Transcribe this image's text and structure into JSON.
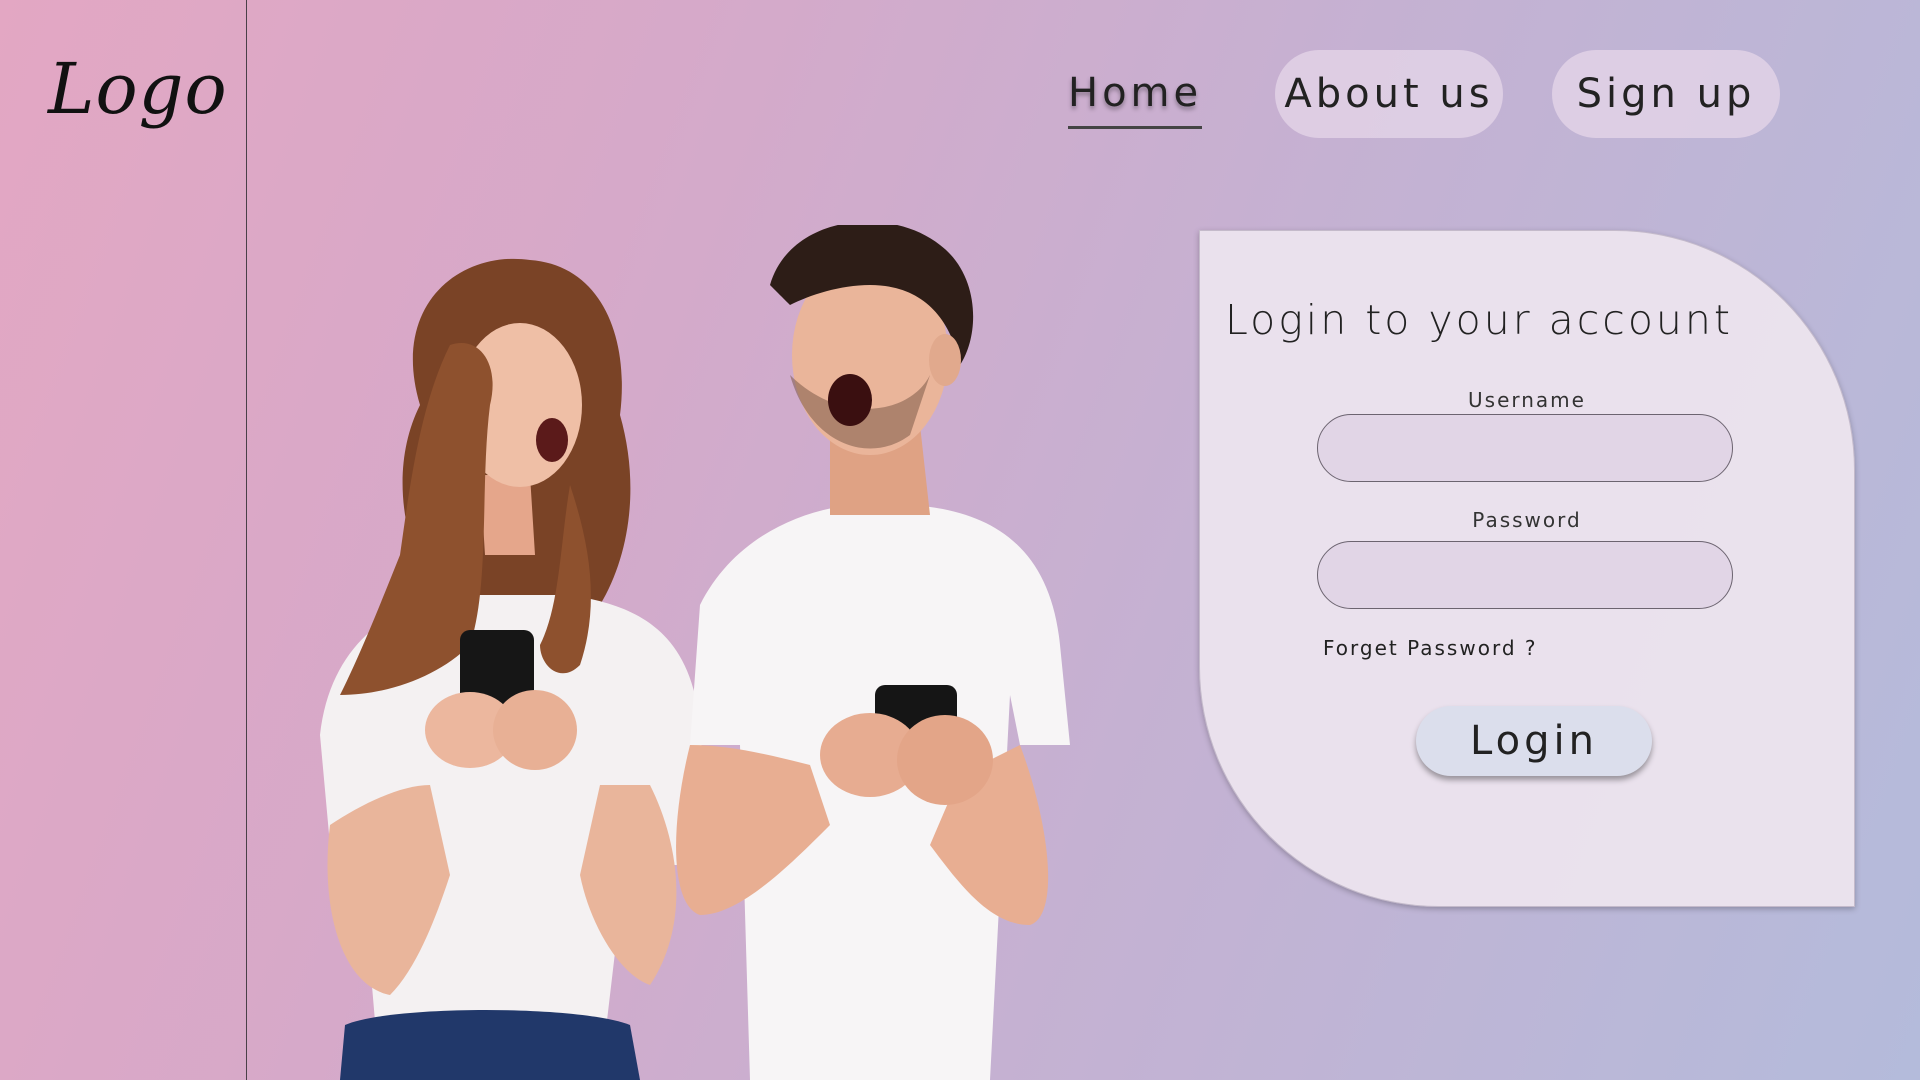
{
  "logo": "Logo",
  "nav": {
    "home": "Home",
    "about": "About us",
    "signup": "Sign up"
  },
  "login": {
    "title": "Login to your account",
    "username_label": "Username",
    "password_label": "Password",
    "forgot": "Forget Password ?",
    "button": "Login"
  },
  "colors": {
    "bg_left": "#e3a7c3",
    "bg_right": "#b4bbdb",
    "card": "#ece4ee",
    "button": "#dbdeec"
  }
}
